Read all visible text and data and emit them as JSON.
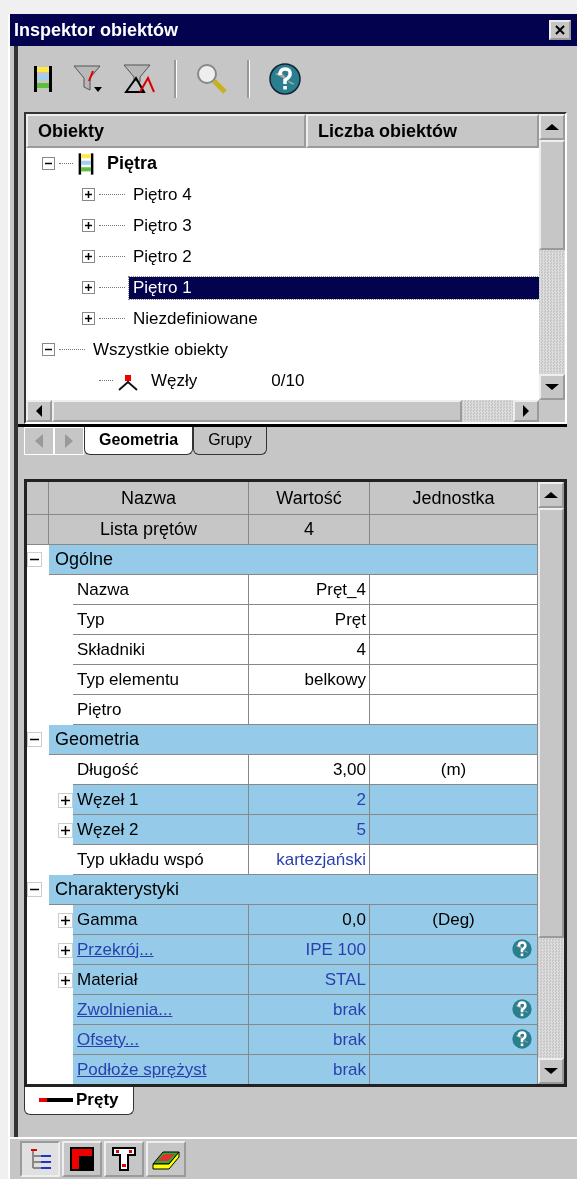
{
  "window": {
    "title": "Inspektor obiektów"
  },
  "tree": {
    "columns": [
      "Obiekty",
      "Liczba obiektów"
    ],
    "items": [
      {
        "label": "Piętra",
        "kind": "floors",
        "expanded": true,
        "selected": false,
        "children": [
          {
            "label": "Piętro 4",
            "kind": "floor",
            "expanded": false,
            "selected": false
          },
          {
            "label": "Piętro 3",
            "kind": "floor",
            "expanded": false,
            "selected": false
          },
          {
            "label": "Piętro 2",
            "kind": "floor",
            "expanded": false,
            "selected": false
          },
          {
            "label": "Piętro 1",
            "kind": "floor",
            "expanded": false,
            "selected": true
          },
          {
            "label": "Niezdefiniowane",
            "kind": "floor",
            "expanded": false,
            "selected": false
          }
        ]
      },
      {
        "label": "Wszystkie obiekty",
        "kind": "group",
        "expanded": true,
        "selected": false,
        "children": [
          {
            "label": "Węzły",
            "kind": "nodes",
            "count": "0/10",
            "selected": false
          }
        ]
      }
    ]
  },
  "tree_tabs": [
    {
      "label": "Geometria",
      "selected": true
    },
    {
      "label": "Grupy",
      "selected": false
    }
  ],
  "grid": {
    "columns": [
      "Nazwa",
      "Wartość",
      "Jednostka"
    ],
    "rows": [
      {
        "kind": "summary",
        "name": "Lista prętów",
        "value": "4"
      },
      {
        "kind": "group",
        "name": "Ogólne",
        "expanded": true
      },
      {
        "kind": "property",
        "name": "Nazwa",
        "value": "Pręt_4",
        "highlighted": false,
        "value_blue": false,
        "link": false
      },
      {
        "kind": "property",
        "name": "Typ",
        "value": "Pręt",
        "highlighted": false,
        "value_blue": false,
        "link": false
      },
      {
        "kind": "property",
        "name": "Składniki",
        "value": "4",
        "highlighted": false,
        "value_blue": false,
        "link": false
      },
      {
        "kind": "property",
        "name": "Typ elementu",
        "value": "belkowy",
        "highlighted": false,
        "value_blue": false,
        "link": false
      },
      {
        "kind": "property",
        "name": "Piętro",
        "highlighted": false,
        "link": false
      },
      {
        "kind": "group",
        "name": "Geometria",
        "expanded": true
      },
      {
        "kind": "property",
        "name": "Długość",
        "value": "3,00",
        "unit": "(m)",
        "highlighted": false,
        "value_blue": false,
        "link": false
      },
      {
        "kind": "property",
        "name": "Węzeł 1",
        "value": "2",
        "expanded": false,
        "highlighted": true,
        "value_blue": true,
        "link": false
      },
      {
        "kind": "property",
        "name": "Węzeł 2",
        "value": "5",
        "expanded": false,
        "highlighted": true,
        "value_blue": true,
        "link": false
      },
      {
        "kind": "property",
        "name": "Typ układu wspó",
        "value": "kartezjański",
        "highlighted": false,
        "value_blue": true,
        "link": false
      },
      {
        "kind": "group",
        "name": "Charakterystyki",
        "expanded": true
      },
      {
        "kind": "property",
        "name": "Gamma",
        "value": "0,0",
        "unit": "(Deg)",
        "expanded": false,
        "highlighted": true,
        "value_blue": false,
        "link": false
      },
      {
        "kind": "property",
        "name": "Przekrój...",
        "value": "IPE 100",
        "expanded": false,
        "highlighted": true,
        "value_blue": true,
        "link": true,
        "help": true
      },
      {
        "kind": "property",
        "name": "Materiał",
        "value": "STAL",
        "expanded": false,
        "highlighted": true,
        "value_blue": true,
        "link": false
      },
      {
        "kind": "property",
        "name": "Zwolnienia...",
        "value": "brak",
        "highlighted": true,
        "value_blue": true,
        "link": true,
        "help": true
      },
      {
        "kind": "property",
        "name": "Ofsety...",
        "value": "brak",
        "highlighted": true,
        "value_blue": true,
        "link": true,
        "help": true
      },
      {
        "kind": "property",
        "name": "Podłoże sprężyst",
        "value": "brak",
        "highlighted": true,
        "value_blue": true,
        "link": true
      }
    ]
  },
  "grid_tabs": [
    {
      "label": "Pręty",
      "selected": true
    }
  ],
  "bottom_tools": [
    {
      "selected": true
    },
    {
      "selected": false
    },
    {
      "selected": false
    },
    {
      "selected": false
    }
  ]
}
